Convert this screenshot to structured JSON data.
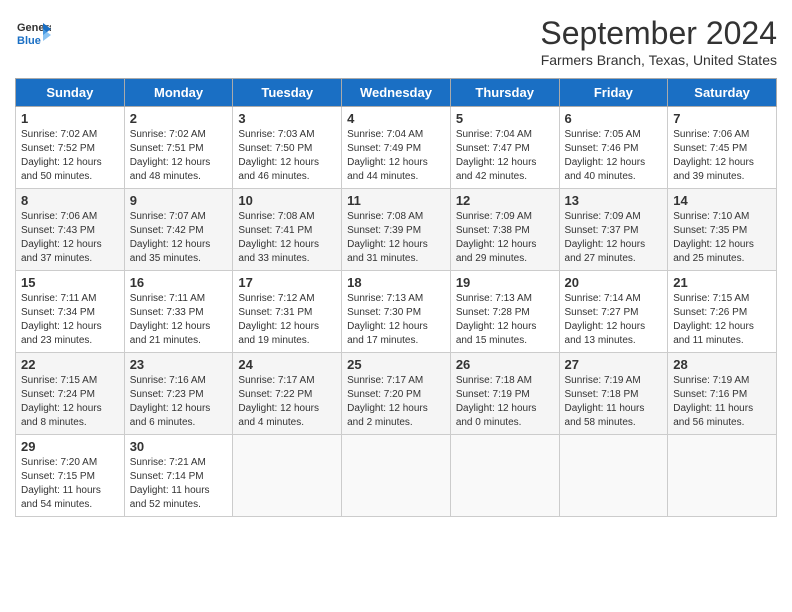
{
  "header": {
    "logo_line1": "General",
    "logo_line2": "Blue",
    "month": "September 2024",
    "location": "Farmers Branch, Texas, United States"
  },
  "days_of_week": [
    "Sunday",
    "Monday",
    "Tuesday",
    "Wednesday",
    "Thursday",
    "Friday",
    "Saturday"
  ],
  "weeks": [
    [
      {
        "day": "1",
        "sunrise": "7:02 AM",
        "sunset": "7:52 PM",
        "daylight": "12 hours and 50 minutes."
      },
      {
        "day": "2",
        "sunrise": "7:02 AM",
        "sunset": "7:51 PM",
        "daylight": "12 hours and 48 minutes."
      },
      {
        "day": "3",
        "sunrise": "7:03 AM",
        "sunset": "7:50 PM",
        "daylight": "12 hours and 46 minutes."
      },
      {
        "day": "4",
        "sunrise": "7:04 AM",
        "sunset": "7:49 PM",
        "daylight": "12 hours and 44 minutes."
      },
      {
        "day": "5",
        "sunrise": "7:04 AM",
        "sunset": "7:47 PM",
        "daylight": "12 hours and 42 minutes."
      },
      {
        "day": "6",
        "sunrise": "7:05 AM",
        "sunset": "7:46 PM",
        "daylight": "12 hours and 40 minutes."
      },
      {
        "day": "7",
        "sunrise": "7:06 AM",
        "sunset": "7:45 PM",
        "daylight": "12 hours and 39 minutes."
      }
    ],
    [
      {
        "day": "8",
        "sunrise": "7:06 AM",
        "sunset": "7:43 PM",
        "daylight": "12 hours and 37 minutes."
      },
      {
        "day": "9",
        "sunrise": "7:07 AM",
        "sunset": "7:42 PM",
        "daylight": "12 hours and 35 minutes."
      },
      {
        "day": "10",
        "sunrise": "7:08 AM",
        "sunset": "7:41 PM",
        "daylight": "12 hours and 33 minutes."
      },
      {
        "day": "11",
        "sunrise": "7:08 AM",
        "sunset": "7:39 PM",
        "daylight": "12 hours and 31 minutes."
      },
      {
        "day": "12",
        "sunrise": "7:09 AM",
        "sunset": "7:38 PM",
        "daylight": "12 hours and 29 minutes."
      },
      {
        "day": "13",
        "sunrise": "7:09 AM",
        "sunset": "7:37 PM",
        "daylight": "12 hours and 27 minutes."
      },
      {
        "day": "14",
        "sunrise": "7:10 AM",
        "sunset": "7:35 PM",
        "daylight": "12 hours and 25 minutes."
      }
    ],
    [
      {
        "day": "15",
        "sunrise": "7:11 AM",
        "sunset": "7:34 PM",
        "daylight": "12 hours and 23 minutes."
      },
      {
        "day": "16",
        "sunrise": "7:11 AM",
        "sunset": "7:33 PM",
        "daylight": "12 hours and 21 minutes."
      },
      {
        "day": "17",
        "sunrise": "7:12 AM",
        "sunset": "7:31 PM",
        "daylight": "12 hours and 19 minutes."
      },
      {
        "day": "18",
        "sunrise": "7:13 AM",
        "sunset": "7:30 PM",
        "daylight": "12 hours and 17 minutes."
      },
      {
        "day": "19",
        "sunrise": "7:13 AM",
        "sunset": "7:28 PM",
        "daylight": "12 hours and 15 minutes."
      },
      {
        "day": "20",
        "sunrise": "7:14 AM",
        "sunset": "7:27 PM",
        "daylight": "12 hours and 13 minutes."
      },
      {
        "day": "21",
        "sunrise": "7:15 AM",
        "sunset": "7:26 PM",
        "daylight": "12 hours and 11 minutes."
      }
    ],
    [
      {
        "day": "22",
        "sunrise": "7:15 AM",
        "sunset": "7:24 PM",
        "daylight": "12 hours and 8 minutes."
      },
      {
        "day": "23",
        "sunrise": "7:16 AM",
        "sunset": "7:23 PM",
        "daylight": "12 hours and 6 minutes."
      },
      {
        "day": "24",
        "sunrise": "7:17 AM",
        "sunset": "7:22 PM",
        "daylight": "12 hours and 4 minutes."
      },
      {
        "day": "25",
        "sunrise": "7:17 AM",
        "sunset": "7:20 PM",
        "daylight": "12 hours and 2 minutes."
      },
      {
        "day": "26",
        "sunrise": "7:18 AM",
        "sunset": "7:19 PM",
        "daylight": "12 hours and 0 minutes."
      },
      {
        "day": "27",
        "sunrise": "7:19 AM",
        "sunset": "7:18 PM",
        "daylight": "11 hours and 58 minutes."
      },
      {
        "day": "28",
        "sunrise": "7:19 AM",
        "sunset": "7:16 PM",
        "daylight": "11 hours and 56 minutes."
      }
    ],
    [
      {
        "day": "29",
        "sunrise": "7:20 AM",
        "sunset": "7:15 PM",
        "daylight": "11 hours and 54 minutes."
      },
      {
        "day": "30",
        "sunrise": "7:21 AM",
        "sunset": "7:14 PM",
        "daylight": "11 hours and 52 minutes."
      },
      null,
      null,
      null,
      null,
      null
    ]
  ]
}
